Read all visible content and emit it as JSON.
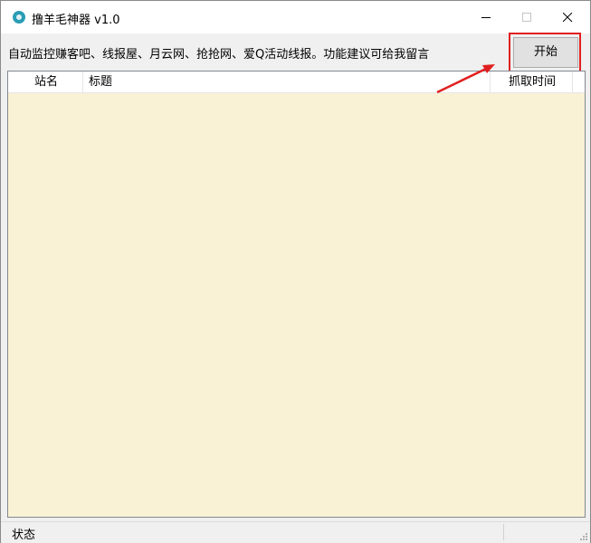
{
  "window": {
    "title": "撸羊毛神器 v1.0",
    "icon": "app-logo-icon"
  },
  "description": "自动监控赚客吧、线报屋、月云网、抢抢网、爱Q活动线报。功能建议可给我留言",
  "start_button": {
    "label": "开始"
  },
  "table": {
    "columns": [
      "站名",
      "标题",
      "抓取时间"
    ],
    "rows": [],
    "background": "#faf2d5"
  },
  "statusbar": {
    "text": "状态"
  },
  "annotation": {
    "color": "#e02020"
  }
}
